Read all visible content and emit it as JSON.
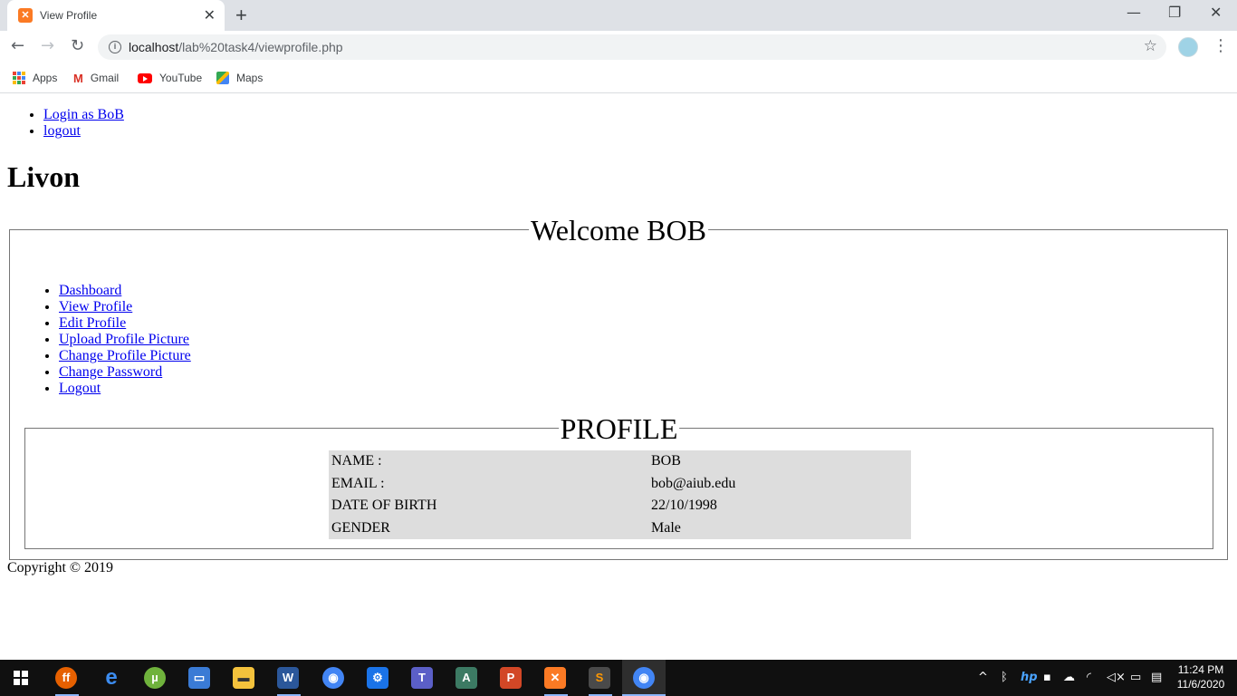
{
  "browser": {
    "tab_title": "View Profile",
    "tab_favicon": "xampp-icon",
    "url_host": "localhost",
    "url_path": "/lab%20task4/viewprofile.php",
    "bookmarks": [
      {
        "label": "Apps",
        "icon": "apps-grid-icon"
      },
      {
        "label": "Gmail",
        "icon": "gmail-icon"
      },
      {
        "label": "YouTube",
        "icon": "youtube-icon"
      },
      {
        "label": "Maps",
        "icon": "maps-icon"
      }
    ]
  },
  "page": {
    "top_nav": [
      "Login as BoB",
      "logout"
    ],
    "site_title": "Livon",
    "welcome_legend": "Welcome BOB",
    "side_nav": [
      "Dashboard",
      "View Profile",
      "Edit Profile",
      "Upload Profile Picture",
      "Change Profile Picture",
      "Change Password",
      "Logout"
    ],
    "profile_legend": "PROFILE",
    "profile_rows": [
      {
        "label": "NAME :",
        "value": "BOB"
      },
      {
        "label": "EMAIL :",
        "value": "bob@aiub.edu"
      },
      {
        "label": "DATE OF BIRTH",
        "value": "22/10/1998"
      },
      {
        "label": "GENDER",
        "value": "Male"
      }
    ],
    "copyright": "Copyright © 2019"
  },
  "taskbar": {
    "time": "11:24 PM",
    "date": "11/6/2020",
    "apps": [
      "firefox-icon",
      "edge-icon",
      "utorrent-icon",
      "remote-icon",
      "file-explorer-icon",
      "word-icon",
      "chrome-beta-icon",
      "settings-icon",
      "teams-icon",
      "acrobat-icon",
      "powerpoint-icon",
      "xampp-icon",
      "sublime-icon",
      "chrome-icon"
    ]
  },
  "colors": {
    "link": "#0000ee",
    "table_bg": "#dddddd",
    "taskbar_bg": "#101010",
    "tabbar_bg": "#dee1e6"
  }
}
